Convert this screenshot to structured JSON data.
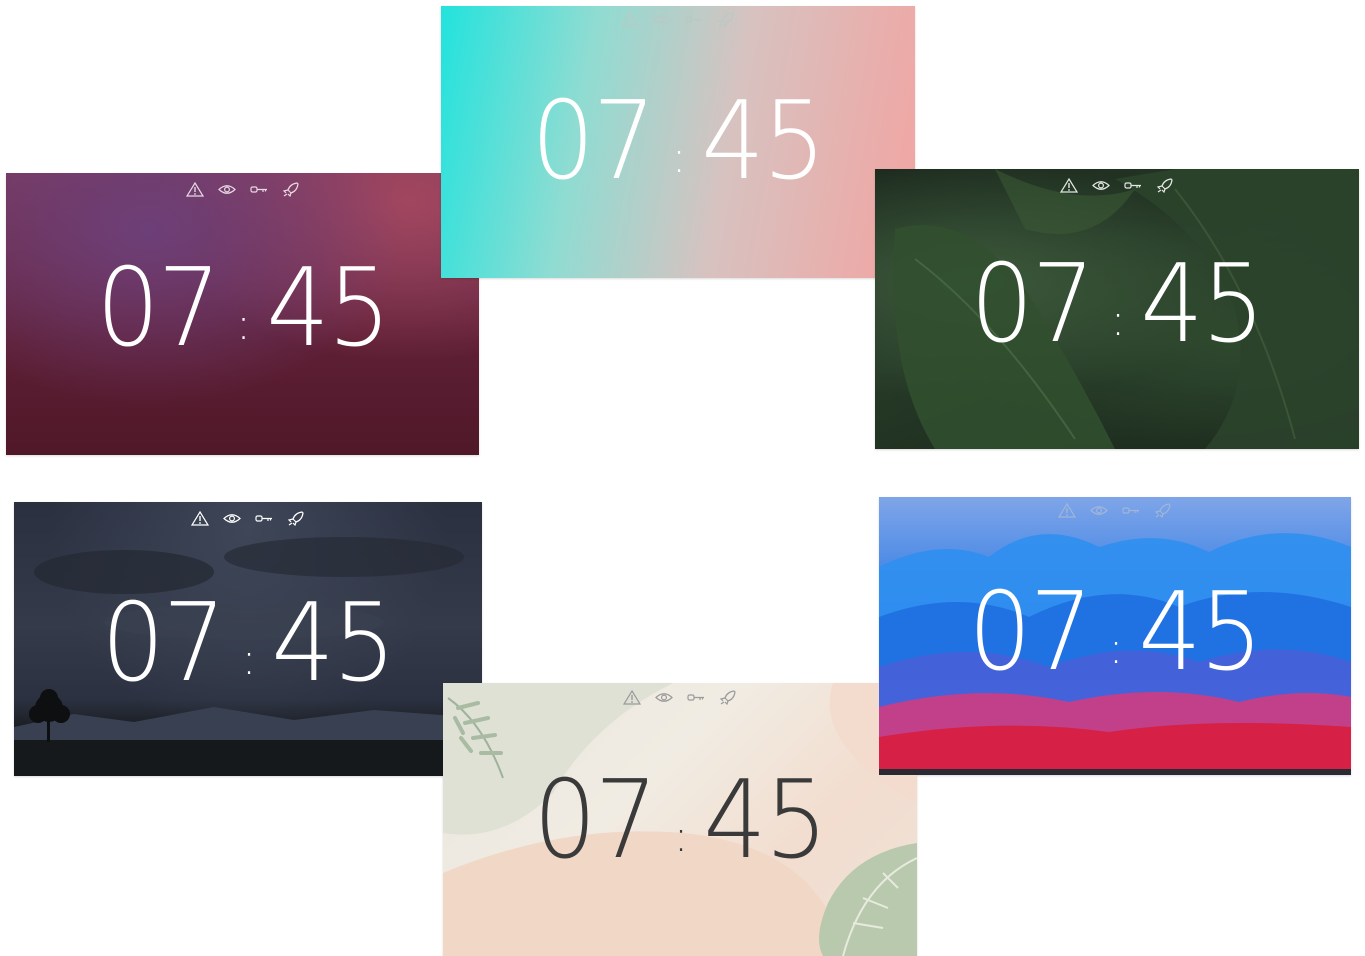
{
  "status_icons": [
    {
      "name": "warning-icon"
    },
    {
      "name": "eye-icon"
    },
    {
      "name": "key-icon"
    },
    {
      "name": "rocket-icon"
    }
  ],
  "cards": [
    {
      "name": "plum-theme-preview",
      "hours": "07",
      "minutes": "45",
      "text_color": "#ffffff",
      "icon_color": "#e8d9e2"
    },
    {
      "name": "gradient-theme-preview",
      "hours": "07",
      "minutes": "45",
      "text_color": "#ffffff",
      "icon_color": "#cfd8d6"
    },
    {
      "name": "leaf-theme-preview",
      "hours": "07",
      "minutes": "45",
      "text_color": "#ffffff",
      "icon_color": "#e4e9e2"
    },
    {
      "name": "night-theme-preview",
      "hours": "07",
      "minutes": "45",
      "text_color": "#ffffff",
      "icon_color": "#ffffff"
    },
    {
      "name": "botanical-theme-preview",
      "hours": "07",
      "minutes": "45",
      "text_color": "#3a3a3a",
      "icon_color": "#9a9a9a"
    },
    {
      "name": "waves-theme-preview",
      "hours": "07",
      "minutes": "45",
      "text_color": "#ffffff",
      "icon_color": "#9fb6d8"
    }
  ]
}
